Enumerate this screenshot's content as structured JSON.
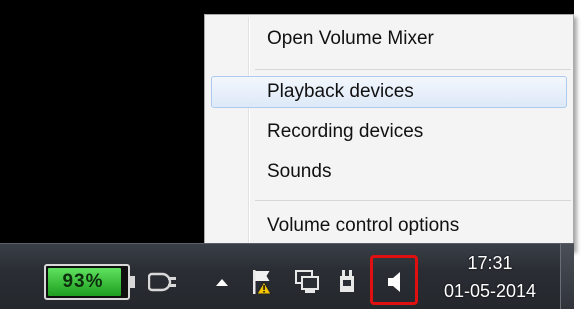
{
  "context_menu": {
    "items": [
      {
        "label": "Open Volume Mixer",
        "highlighted": false
      },
      {
        "label": "Playback devices",
        "highlighted": true
      },
      {
        "label": "Recording devices",
        "highlighted": false
      },
      {
        "label": "Sounds",
        "highlighted": false
      },
      {
        "label": "Volume control options",
        "highlighted": false
      }
    ]
  },
  "taskbar": {
    "battery": {
      "percent_label": "93%",
      "level_percent": 93,
      "fill_color": "#2fbf2f"
    },
    "tray_icons": [
      "power-plug-icon",
      "show-hidden-icons-arrow",
      "action-center-flag-icon",
      "network-icon",
      "power-icon",
      "speaker-icon"
    ],
    "clock": {
      "time": "17:31",
      "date": "01-05-2014"
    },
    "highlight_color": "#e01010"
  }
}
